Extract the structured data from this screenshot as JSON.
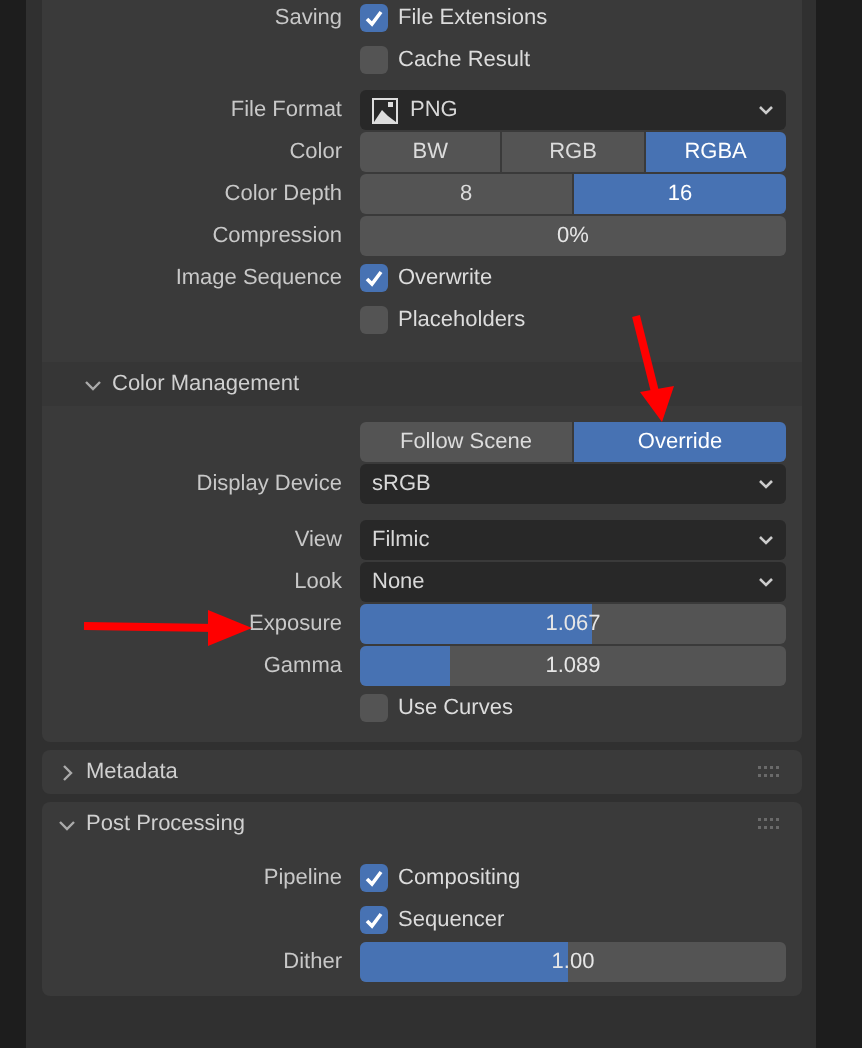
{
  "panels": [
    {
      "rows": [
        {
          "kind": "checkbox",
          "label": "Saving",
          "text": "File Extensions",
          "checked": true
        },
        {
          "kind": "checkbox",
          "text": "Cache Result",
          "checked": false
        },
        {
          "kind": "image_dropdown",
          "label": "File Format",
          "value": "PNG"
        },
        {
          "kind": "segmented",
          "label": "Color",
          "options": [
            {
              "label": "BW",
              "selected": false
            },
            {
              "label": "RGB",
              "selected": false
            },
            {
              "label": "RGBA",
              "selected": true
            }
          ]
        },
        {
          "kind": "segmented",
          "label": "Color Depth",
          "options": [
            {
              "label": "8",
              "selected": false
            },
            {
              "label": "16",
              "selected": true
            }
          ]
        },
        {
          "kind": "slider",
          "label": "Compression",
          "value": "0%",
          "level": 0
        },
        {
          "kind": "checkbox",
          "label": "Image Sequence",
          "text": "Overwrite",
          "checked": true
        },
        {
          "kind": "checkbox",
          "text": "Placeholders",
          "checked": false
        }
      ],
      "subpanel": {
        "title": "Color Management",
        "expanded": true,
        "rows": [
          {
            "kind": "segmented",
            "options": [
              {
                "label": "Follow Scene",
                "selected": false
              },
              {
                "label": "Override",
                "selected": true
              }
            ]
          },
          {
            "kind": "dropdown",
            "label": "Display Device",
            "value": "sRGB"
          },
          {
            "kind": "dropdown",
            "label": "View",
            "value": "Filmic"
          },
          {
            "kind": "dropdown",
            "label": "Look",
            "value": "None"
          },
          {
            "kind": "slider",
            "label": "Exposure",
            "value": "1.067",
            "level": 0.545
          },
          {
            "kind": "slider",
            "label": "Gamma",
            "value": "1.089",
            "level": 0.21
          },
          {
            "kind": "checkbox",
            "text": "Use Curves",
            "checked": false
          }
        ]
      }
    },
    {
      "title": "Metadata",
      "expanded": false
    },
    {
      "title": "Post Processing",
      "expanded": true,
      "rows": [
        {
          "kind": "checkbox",
          "label": "Pipeline",
          "text": "Compositing",
          "checked": true
        },
        {
          "kind": "checkbox",
          "text": "Sequencer",
          "checked": true
        },
        {
          "kind": "slider",
          "label": "Dither",
          "value": "1.00",
          "level": 0.49
        }
      ]
    }
  ]
}
